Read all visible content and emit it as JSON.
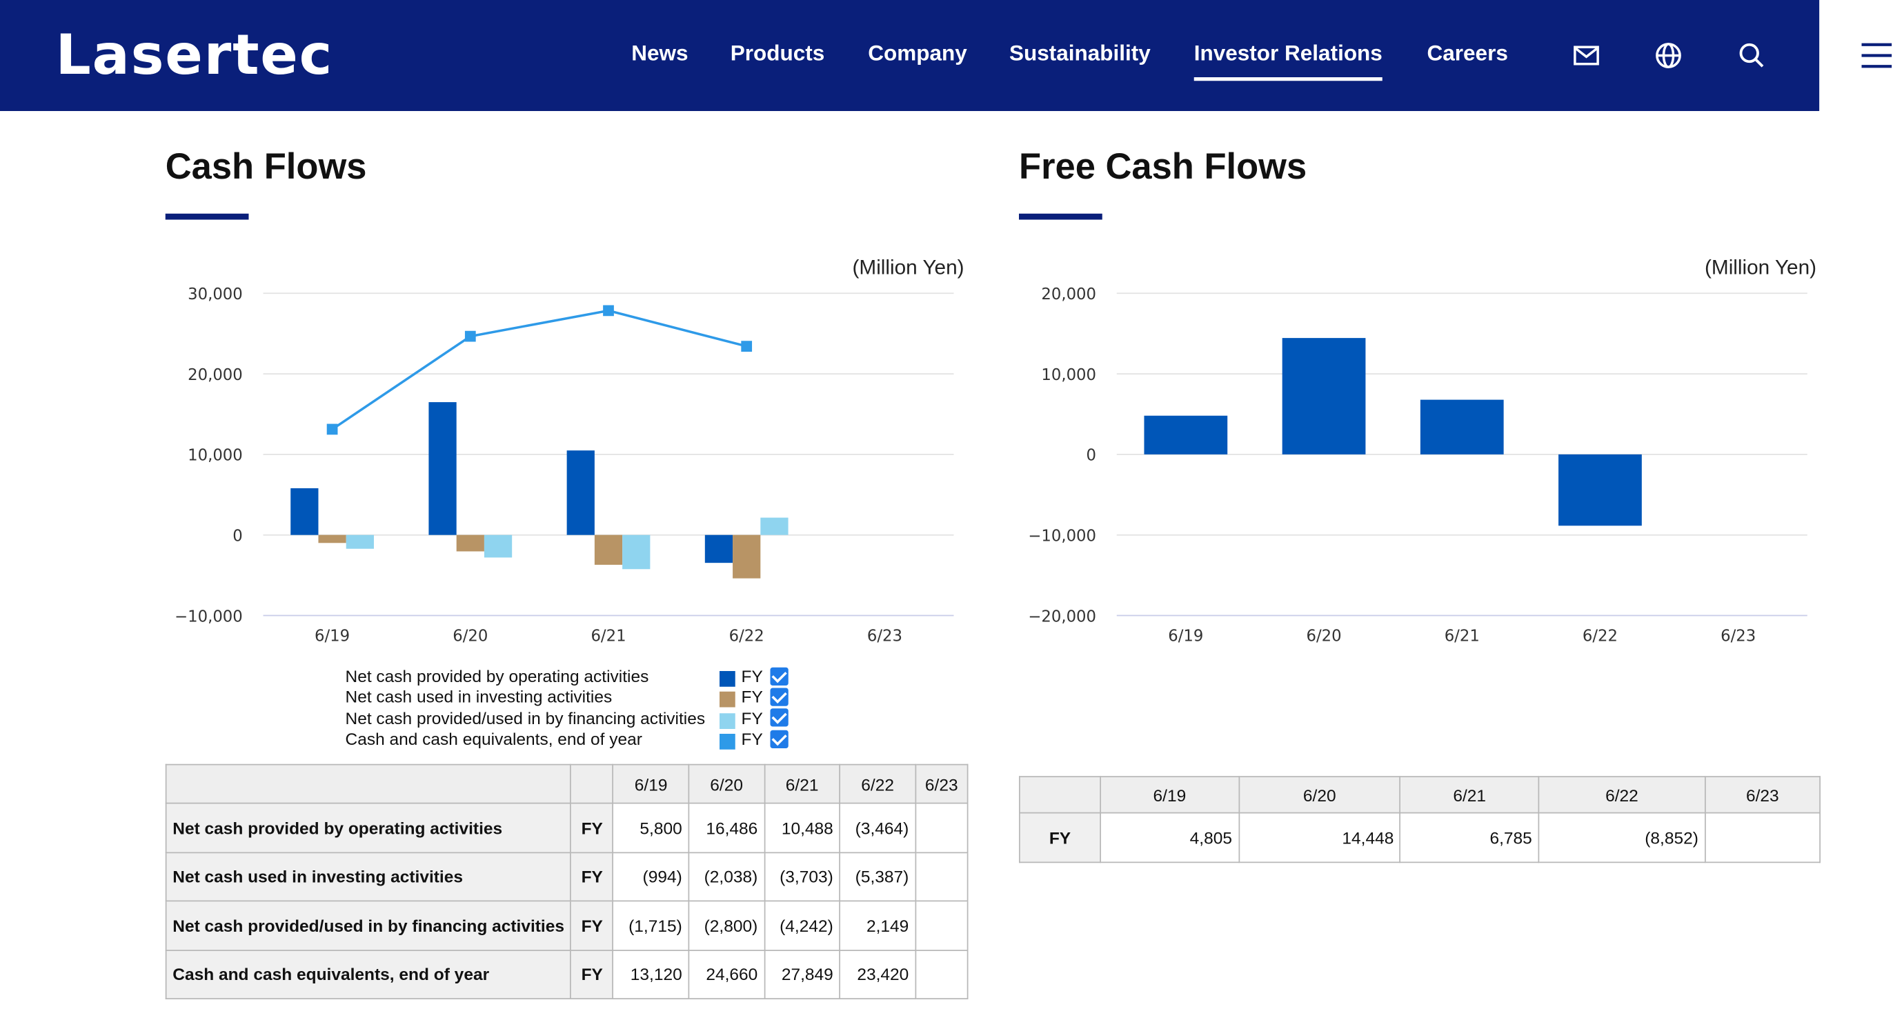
{
  "header": {
    "logo": "Lasertec",
    "nav": [
      "News",
      "Products",
      "Company",
      "Sustainability",
      "Investor Relations",
      "Careers"
    ],
    "active_nav": "Investor Relations",
    "icons": [
      "mail-icon",
      "globe-icon",
      "search-icon",
      "menu-icon"
    ]
  },
  "colors": {
    "header_bg": "#0a1f7a",
    "operating": "#0056b8",
    "investing": "#b89465",
    "financing": "#8fd4ef",
    "cash_end": "#2e9ae8",
    "fcf": "#0056b8"
  },
  "cash_flows": {
    "title": "Cash Flows",
    "unit": "(Million Yen)",
    "legend": [
      {
        "label": "Net cash provided by operating activities",
        "tag": "FY"
      },
      {
        "label": "Net cash used in investing activities",
        "tag": "FY"
      },
      {
        "label": "Net cash provided/used in by financing activities",
        "tag": "FY"
      },
      {
        "label": "Cash and cash equivalents, end of year",
        "tag": "FY"
      }
    ],
    "table": {
      "columns": [
        "6/19",
        "6/20",
        "6/21",
        "6/22",
        "6/23"
      ],
      "rows": [
        {
          "label": "Net cash provided by operating activities",
          "tag": "FY",
          "cells": [
            "5,800",
            "16,486",
            "10,488",
            "(3,464)",
            ""
          ]
        },
        {
          "label": "Net cash used in investing activities",
          "tag": "FY",
          "cells": [
            "(994)",
            "(2,038)",
            "(3,703)",
            "(5,387)",
            ""
          ]
        },
        {
          "label": "Net cash provided/used in by financing activities",
          "tag": "FY",
          "cells": [
            "(1,715)",
            "(2,800)",
            "(4,242)",
            "2,149",
            ""
          ]
        },
        {
          "label": "Cash and cash equivalents, end of year",
          "tag": "FY",
          "cells": [
            "13,120",
            "24,660",
            "27,849",
            "23,420",
            ""
          ]
        }
      ]
    }
  },
  "free_cash_flows": {
    "title": "Free Cash Flows",
    "unit": "(Million Yen)",
    "table": {
      "columns": [
        "6/19",
        "6/20",
        "6/21",
        "6/22",
        "6/23"
      ],
      "rows": [
        {
          "tag": "FY",
          "cells": [
            "4,805",
            "14,448",
            "6,785",
            "(8,852)",
            ""
          ]
        }
      ]
    }
  },
  "chart_data": [
    {
      "type": "bar",
      "title": "",
      "categories": [
        "6/19",
        "6/20",
        "6/21",
        "6/22",
        "6/23"
      ],
      "ylim": [
        -10000,
        30000
      ],
      "yticks": [
        30000,
        20000,
        10000,
        0,
        -10000
      ],
      "ytick_labels": [
        "30,000",
        "20,000",
        "10,000",
        "0",
        "−10,000"
      ],
      "grid": true,
      "legend_position": "bottom",
      "series": [
        {
          "name": "Net cash provided by operating activities",
          "kind": "bar",
          "color": "#0056b8",
          "values": [
            5800,
            16486,
            10488,
            -3464,
            null
          ]
        },
        {
          "name": "Net cash used in investing activities",
          "kind": "bar",
          "color": "#b89465",
          "values": [
            -994,
            -2038,
            -3703,
            -5387,
            null
          ]
        },
        {
          "name": "Net cash provided/used in by financing activities",
          "kind": "bar",
          "color": "#8fd4ef",
          "values": [
            -1715,
            -2800,
            -4242,
            2149,
            null
          ]
        },
        {
          "name": "Cash and cash equivalents, end of year",
          "kind": "line",
          "color": "#2e9ae8",
          "values": [
            13120,
            24660,
            27849,
            23420,
            null
          ]
        }
      ]
    },
    {
      "type": "bar",
      "title": "",
      "categories": [
        "6/19",
        "6/20",
        "6/21",
        "6/22",
        "6/23"
      ],
      "ylim": [
        -20000,
        20000
      ],
      "yticks": [
        20000,
        10000,
        0,
        -10000,
        -20000
      ],
      "ytick_labels": [
        "20,000",
        "10,000",
        "0",
        "−10,000",
        "−20,000"
      ],
      "grid": true,
      "series": [
        {
          "kind": "bar",
          "color": "#0056b8",
          "values": [
            4805,
            14448,
            6785,
            -8852,
            null
          ]
        }
      ]
    }
  ]
}
